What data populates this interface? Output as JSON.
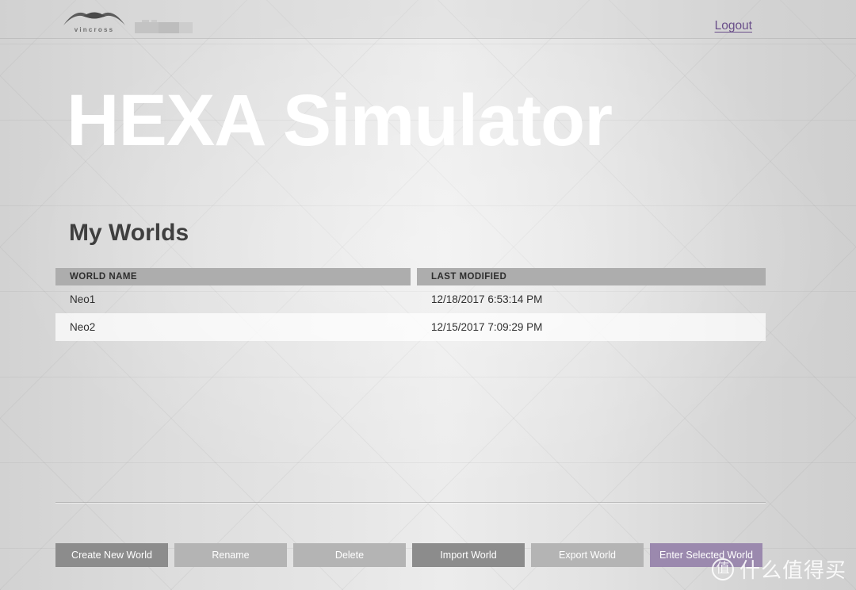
{
  "header": {
    "brand_name": "vincross",
    "brand_icon": "vincross-bird-logo",
    "account_redacted": "",
    "logout_label": "Logout"
  },
  "hero": {
    "title": "HEXA Simulator"
  },
  "main": {
    "section_title": "My Worlds",
    "table": {
      "columns": [
        "WORLD NAME",
        "LAST MODIFIED"
      ],
      "rows": [
        {
          "name": "Neo1",
          "modified": "12/18/2017 6:53:14 PM",
          "selected": false
        },
        {
          "name": "Neo2",
          "modified": "12/15/2017 7:09:29 PM",
          "selected": true
        }
      ]
    }
  },
  "toolbar": {
    "create_label": "Create New World",
    "rename_label": "Rename",
    "delete_label": "Delete",
    "import_label": "Import World",
    "export_label": "Export World",
    "enter_label": "Enter Selected World"
  },
  "watermark": {
    "badge": "值",
    "text": "什么值得买"
  },
  "colors": {
    "accent_purple": "#9b89ae",
    "link_purple": "#6a4f8a",
    "button_dark": "#8c8c8c",
    "button_light": "#b4b4b4",
    "table_header": "#adadad",
    "page_bg": "#dadada",
    "title_white": "#ffffff"
  }
}
